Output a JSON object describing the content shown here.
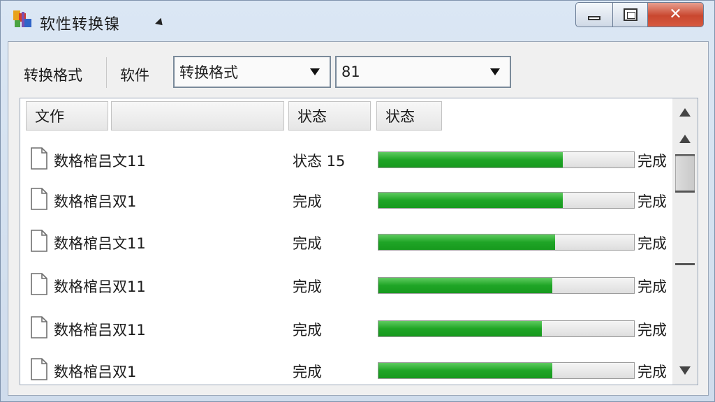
{
  "window": {
    "title": "软性转换镍",
    "close_glyph": "✕"
  },
  "toolbar": {
    "label_convert": "转换格式",
    "label_software": "软件",
    "combo_format": "转换格式",
    "combo_number": "81"
  },
  "list": {
    "columns": [
      "文作",
      "",
      "状态",
      "状态"
    ],
    "rows": [
      {
        "name": "数格棺吕文11",
        "status": "状态 15",
        "progress": 0.72,
        "done": "完成"
      },
      {
        "name": "数格棺吕双1",
        "status": "完成",
        "progress": 0.72,
        "done": "完成"
      },
      {
        "name": "数格棺吕文11",
        "status": "完成",
        "progress": 0.69,
        "done": "完成"
      },
      {
        "name": "数格棺吕双11",
        "status": "完成",
        "progress": 0.68,
        "done": "完成"
      },
      {
        "name": "数格棺吕双11",
        "status": "完成",
        "progress": 0.64,
        "done": "完成"
      },
      {
        "name": "数格棺吕双1",
        "status": "完成",
        "progress": 0.68,
        "done": "完成"
      }
    ]
  },
  "colors": {
    "progress_green": "#1fa526",
    "close_red": "#c9472f"
  },
  "icons": {
    "app": "app-logo-icon",
    "file": "document-icon"
  }
}
